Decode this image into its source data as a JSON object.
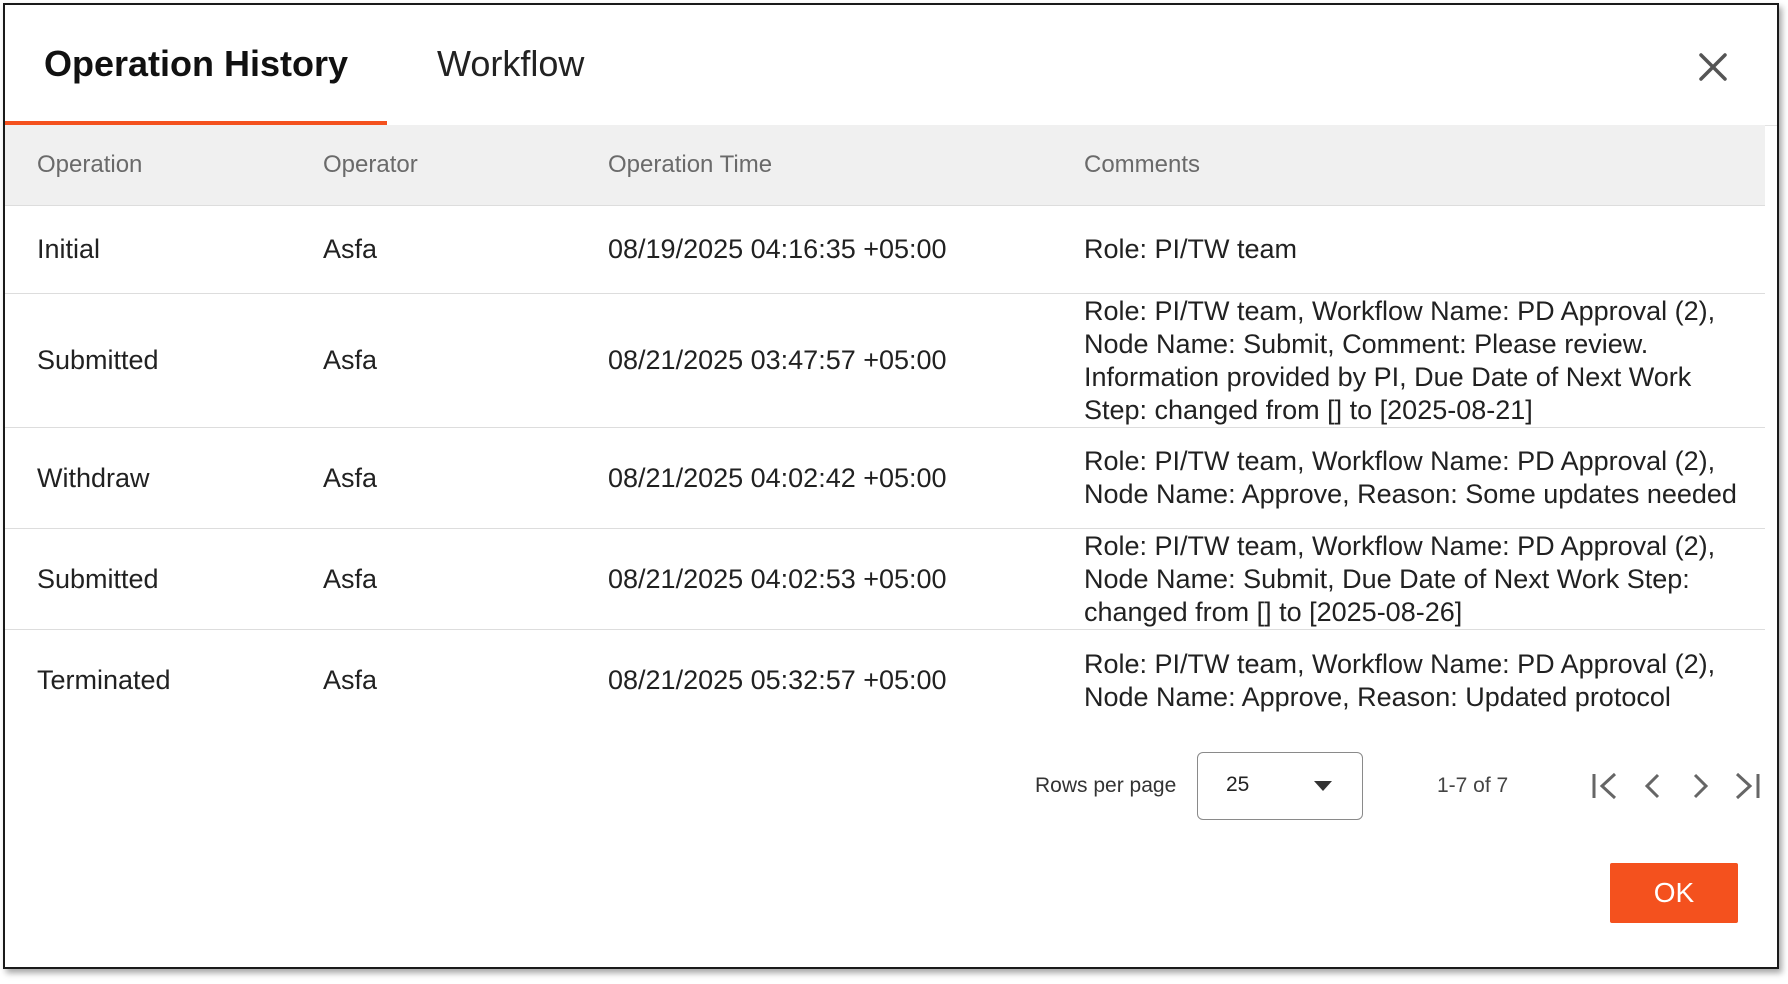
{
  "tabs": [
    {
      "label": "Operation History",
      "active": true
    },
    {
      "label": "Workflow",
      "active": false
    }
  ],
  "table": {
    "columns": [
      "Operation",
      "Operator",
      "Operation Time",
      "Comments"
    ],
    "rows": [
      {
        "operation": "Initial",
        "operator": "Asfa",
        "time": "08/19/2025 04:16:35 +05:00",
        "comments": "Role: PI/TW team"
      },
      {
        "operation": "Submitted",
        "operator": "Asfa",
        "time": "08/21/2025 03:47:57 +05:00",
        "comments": "Role: PI/TW team, Workflow Name: PD Approval (2), Node Name: Submit, Comment: Please review. Information provided by PI, Due Date of Next Work Step: changed from [] to [2025-08-21]"
      },
      {
        "operation": "Withdraw",
        "operator": "Asfa",
        "time": "08/21/2025 04:02:42 +05:00",
        "comments": "Role: PI/TW team, Workflow Name: PD Approval (2), Node Name: Approve, Reason: Some updates needed"
      },
      {
        "operation": "Submitted",
        "operator": "Asfa",
        "time": "08/21/2025 04:02:53 +05:00",
        "comments": "Role: PI/TW team, Workflow Name: PD Approval (2), Node Name: Submit, Due Date of Next Work Step: changed from [] to [2025-08-26]"
      },
      {
        "operation": "Terminated",
        "operator": "Asfa",
        "time": "08/21/2025 05:32:57 +05:00",
        "comments": "Role: PI/TW team, Workflow Name: PD Approval (2), Node Name: Approve, Reason: Updated protocol"
      }
    ]
  },
  "pagination": {
    "rows_per_page_label": "Rows per page",
    "rows_per_page_value": "25",
    "range_label": "1-7 of 7"
  },
  "footer": {
    "ok_label": "OK"
  },
  "icons": {
    "close": "close-icon",
    "caret": "caret-down-icon",
    "first": "first-page-icon",
    "prev": "chevron-left-icon",
    "next": "chevron-right-icon",
    "last": "last-page-icon"
  },
  "colors": {
    "accent": "#f4511e",
    "header_bg": "#f0f0f0"
  }
}
